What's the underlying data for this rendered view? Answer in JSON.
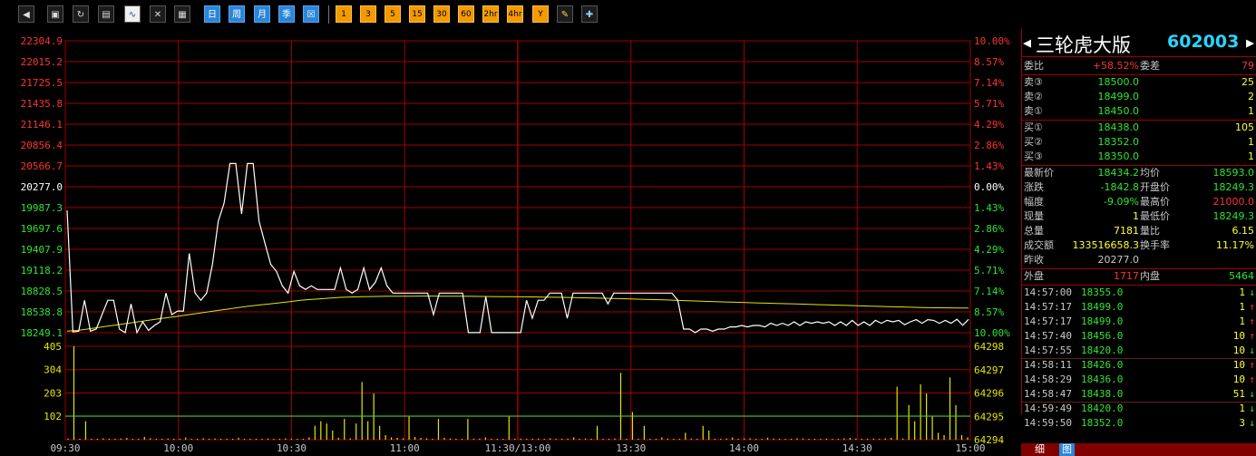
{
  "toolbar": {
    "icons": [
      "back-icon",
      "box-icon",
      "refresh-icon",
      "clipboard-icon",
      "line-chart-icon",
      "indicator-icon",
      "table-icon"
    ],
    "periods": [
      "日",
      "周",
      "月",
      "季",
      "☒"
    ],
    "minutes": [
      "1",
      "3",
      "5",
      "15",
      "30",
      "60",
      "2hr",
      "4hr",
      "Y"
    ],
    "tools": [
      "pencil-icon",
      "tools-icon"
    ]
  },
  "colors": {
    "up": "#ff3232",
    "down": "#2ee52e",
    "flat": "#ffffff",
    "grid": "#a00000",
    "price_line": "#ffffff",
    "avg_line": "#e6e600",
    "volume": "#e6e600",
    "vol_ref": "#2ee52e"
  },
  "chart": {
    "price_ticks": [
      "22304.9",
      "22015.2",
      "21725.5",
      "21435.8",
      "21146.1",
      "20856.4",
      "20566.7",
      "20277.0",
      "19987.3",
      "19697.6",
      "19407.9",
      "19118.2",
      "18828.5",
      "18538.8",
      "18249.1"
    ],
    "pct_ticks": [
      "10.00%",
      "8.57%",
      "7.14%",
      "5.71%",
      "4.29%",
      "2.86%",
      "1.43%",
      "0.00%",
      "1.43%",
      "2.86%",
      "4.29%",
      "5.71%",
      "7.14%",
      "8.57%",
      "10.00%"
    ],
    "volume_ticks_left": [
      "405",
      "304",
      "203",
      "102"
    ],
    "volume_ticks_right": [
      "64298",
      "64297",
      "64296",
      "64295",
      "64294"
    ],
    "time_labels": [
      "09:30",
      "10:00",
      "10:30",
      "11:00",
      "11:30/13:00",
      "13:30",
      "14:00",
      "14:30",
      "15:00"
    ]
  },
  "chart_data": {
    "type": "line",
    "x_labels": [
      "09:30",
      "10:00",
      "10:30",
      "11:00",
      "11:30/13:00",
      "13:30",
      "14:00",
      "14:30",
      "15:00"
    ],
    "ylim": [
      18249.1,
      22304.9
    ],
    "prev_close": 20277.0,
    "series": [],
    "price": [
      19950,
      18260,
      18270,
      18700,
      18270,
      18300,
      18500,
      18700,
      18700,
      18300,
      18250,
      18650,
      18250,
      18400,
      18280,
      18350,
      18400,
      18800,
      18500,
      18550,
      18550,
      19350,
      18800,
      18700,
      18800,
      19200,
      19800,
      20050,
      20600,
      20600,
      19900,
      20600,
      20600,
      19800,
      19500,
      19200,
      19100,
      18900,
      18800,
      19100,
      18900,
      18850,
      18900,
      18850,
      18850,
      18850,
      18850,
      19150,
      18850,
      18800,
      18850,
      19150,
      18850,
      18950,
      19150,
      18900,
      18800,
      18800,
      18800,
      18800,
      18800,
      18800,
      18800,
      18500,
      18800,
      18800,
      18800,
      18800,
      18800,
      18250,
      18250,
      18250,
      18750,
      18250,
      18250,
      18250,
      18250,
      18250,
      18250,
      18700,
      18450,
      18700,
      18700,
      18800,
      18800,
      18800,
      18450,
      18800,
      18800,
      18800,
      18800,
      18800,
      18800,
      18650,
      18800,
      18800,
      18800,
      18800,
      18800,
      18800,
      18800,
      18800,
      18800,
      18800,
      18800,
      18700,
      18300,
      18300,
      18250,
      18300,
      18300,
      18270,
      18300,
      18300,
      18330,
      18330,
      18350,
      18330,
      18350,
      18350,
      18330,
      18380,
      18350,
      18380,
      18350,
      18400,
      18350,
      18400,
      18380,
      18400,
      18380,
      18400,
      18350,
      18400,
      18350,
      18420,
      18350,
      18400,
      18350,
      18420,
      18380,
      18420,
      18400,
      18420,
      18360,
      18400,
      18430,
      18380,
      18430,
      18420,
      18380,
      18420,
      18380,
      18435,
      18352,
      18434
    ],
    "avg": [
      18270,
      18280,
      18300,
      18320,
      18340,
      18360,
      18380,
      18400,
      18420,
      18440,
      18460,
      18480,
      18500,
      18520,
      18540,
      18560,
      18580,
      18600,
      18620,
      18635,
      18650,
      18665,
      18680,
      18700,
      18710,
      18720,
      18730,
      18740,
      18745,
      18750,
      18752,
      18754,
      18755,
      18756,
      18757,
      18758,
      18758,
      18757,
      18756,
      18755,
      18754,
      18753,
      18752,
      18751,
      18750,
      18748,
      18746,
      18744,
      18742,
      18740,
      18737,
      18734,
      18731,
      18728,
      18725,
      18721,
      18717,
      18713,
      18709,
      18705,
      18700,
      18695,
      18690,
      18685,
      18680,
      18676,
      18672,
      18668,
      18664,
      18660,
      18656,
      18652,
      18648,
      18644,
      18640,
      18636,
      18632,
      18628,
      18624,
      18620,
      18616,
      18612,
      18608,
      18604,
      18600,
      18597,
      18595,
      18594,
      18593,
      18593
    ],
    "volume_ylim": [
      0,
      405
    ],
    "volume_ref": 102,
    "volume": [
      5,
      405,
      3,
      80,
      4,
      2,
      6,
      3,
      4,
      5,
      8,
      3,
      4,
      12,
      6,
      3,
      2,
      5,
      3,
      4,
      10,
      4,
      3,
      6,
      2,
      5,
      3,
      2,
      4,
      8,
      3,
      2,
      3,
      4,
      5,
      3,
      2,
      6,
      4,
      3,
      2,
      10,
      60,
      80,
      70,
      40,
      8,
      90,
      6,
      70,
      250,
      80,
      200,
      60,
      20,
      10,
      8,
      6,
      100,
      12,
      8,
      6,
      4,
      90,
      8,
      5,
      4,
      3,
      90,
      4,
      5,
      10,
      3,
      4,
      2,
      100,
      4,
      5,
      3,
      2,
      5,
      4,
      6,
      3,
      4,
      5,
      10,
      4,
      5,
      3,
      60,
      3,
      4,
      5,
      290,
      3,
      120,
      4,
      60,
      3,
      4,
      10,
      5,
      3,
      4,
      30,
      5,
      3,
      60,
      40,
      3,
      4,
      5,
      10,
      3,
      5,
      6,
      3,
      4,
      8,
      5,
      3,
      4,
      3,
      6,
      5,
      4,
      3,
      4,
      5,
      3,
      4,
      6,
      8,
      5,
      4,
      3,
      5,
      4,
      6,
      8,
      230,
      5,
      150,
      80,
      240,
      200,
      100,
      30,
      20,
      270,
      150,
      20,
      10
    ]
  },
  "panel": {
    "name": "三轮虎大版",
    "code": "602003",
    "weibi": {
      "label": "委比",
      "value": "+58.52%",
      "label2": "委差",
      "value2": "79"
    },
    "sell": [
      {
        "label": "卖③",
        "price": "18500.0",
        "vol": "25"
      },
      {
        "label": "卖②",
        "price": "18499.0",
        "vol": "2"
      },
      {
        "label": "卖①",
        "price": "18450.0",
        "vol": "1"
      }
    ],
    "buy": [
      {
        "label": "买①",
        "price": "18438.0",
        "vol": "105"
      },
      {
        "label": "买②",
        "price": "18352.0",
        "vol": "1"
      },
      {
        "label": "买③",
        "price": "18350.0",
        "vol": "1"
      }
    ],
    "stats": [
      {
        "l1": "最新价",
        "v1": "18434.2",
        "c1": "#2ee52e",
        "l2": "均价",
        "v2": "18593.0",
        "c2": "#2ee52e"
      },
      {
        "l1": "涨跌",
        "v1": "-1842.8",
        "c1": "#2ee52e",
        "l2": "开盘价",
        "v2": "18249.3",
        "c2": "#2ee52e"
      },
      {
        "l1": "幅度",
        "v1": "-9.09%",
        "c1": "#2ee52e",
        "l2": "最高价",
        "v2": "21000.0",
        "c2": "#ff3232"
      },
      {
        "l1": "现量",
        "v1": "1",
        "c1": "#ffff33",
        "l2": "最低价",
        "v2": "18249.3",
        "c2": "#2ee52e"
      },
      {
        "l1": "总量",
        "v1": "7181",
        "c1": "#ffff33",
        "l2": "量比",
        "v2": "6.15",
        "c2": "#ffff33"
      },
      {
        "l1": "成交额",
        "v1": "133516658.3",
        "c1": "#ffff33",
        "l2": "换手率",
        "v2": "11.17%",
        "c2": "#ffff33"
      },
      {
        "l1": "昨收",
        "v1": "20277.0",
        "c1": "#c8c8c8",
        "l2": "",
        "v2": "",
        "c2": "#c8c8c8"
      }
    ],
    "waipan": {
      "label": "外盘",
      "value": "1717",
      "label2": "内盘",
      "value2": "5464"
    },
    "ticks": [
      {
        "time": "14:57:00",
        "price": "18355.0",
        "vol": "1",
        "dir": "↓",
        "dc": "#2ee52e"
      },
      {
        "time": "14:57:17",
        "price": "18499.0",
        "vol": "1",
        "dir": "↑",
        "dc": "#ff3232"
      },
      {
        "time": "14:57:17",
        "price": "18499.0",
        "vol": "1",
        "dir": "↑",
        "dc": "#ff3232"
      },
      {
        "time": "14:57:40",
        "price": "18456.0",
        "vol": "10",
        "dir": "↑",
        "dc": "#ff3232"
      },
      {
        "time": "14:57:55",
        "price": "18420.0",
        "vol": "10",
        "dir": "↓",
        "dc": "#2ee52e"
      },
      {
        "time": "14:58:11",
        "price": "18426.0",
        "vol": "10",
        "dir": "↑",
        "dc": "#ff3232"
      },
      {
        "time": "14:58:29",
        "price": "18436.0",
        "vol": "10",
        "dir": "↑",
        "dc": "#ff3232"
      },
      {
        "time": "14:58:47",
        "price": "18438.0",
        "vol": "51",
        "dir": "↓",
        "dc": "#2ee52e"
      },
      {
        "time": "14:59:49",
        "price": "18420.0",
        "vol": "1",
        "dir": "↓",
        "dc": "#2ee52e"
      },
      {
        "time": "14:59:50",
        "price": "18352.0",
        "vol": "3",
        "dir": "↓",
        "dc": "#2ee52e"
      }
    ],
    "tabs": [
      "细",
      "图"
    ]
  }
}
